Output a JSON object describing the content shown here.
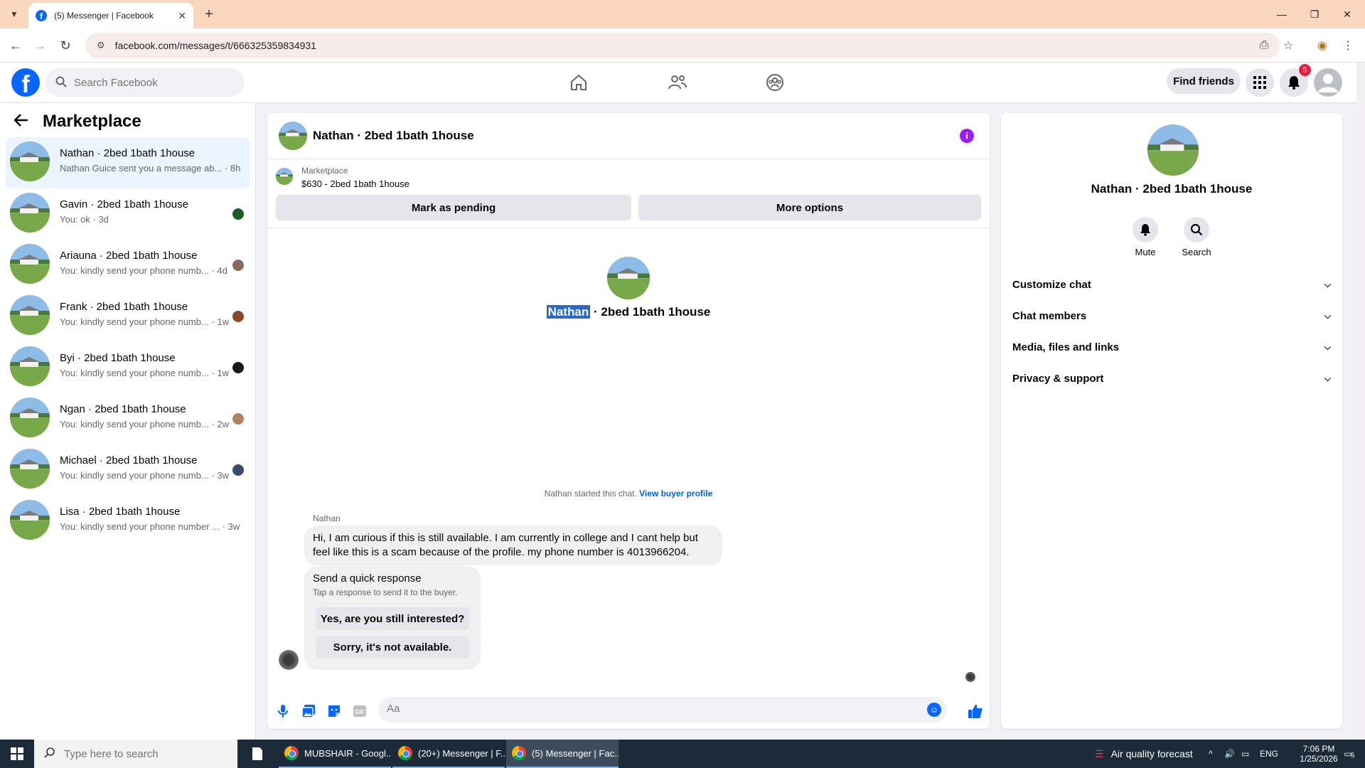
{
  "browser": {
    "tab_title": "(5) Messenger | Facebook",
    "url": "facebook.com/messages/t/666325359834931"
  },
  "fb": {
    "search_placeholder": "Search Facebook",
    "find_friends": "Find friends",
    "notification_count": "5"
  },
  "sidebar": {
    "title": "Marketplace",
    "conversations": [
      {
        "name": "Nathan · 2bed 1bath 1house",
        "preview": "Nathan Guice sent you a message ab... · 8h",
        "mini_color": ""
      },
      {
        "name": "Gavin · 2bed 1bath 1house",
        "preview": "You: ok · 3d",
        "mini_color": "#1e5a2a"
      },
      {
        "name": "Ariauna · 2bed 1bath 1house",
        "preview": "You: kindly send your phone numb... · 4d",
        "mini_color": "#8a6a5a"
      },
      {
        "name": "Frank · 2bed 1bath 1house",
        "preview": "You: kindly send your phone numb... · 1w",
        "mini_color": "#8a4a2a"
      },
      {
        "name": "Byi · 2bed 1bath 1house",
        "preview": "You: kindly send your phone numb... · 1w",
        "mini_color": "#1a1a1a"
      },
      {
        "name": "Ngan · 2bed 1bath 1house",
        "preview": "You: kindly send your phone numb... · 2w",
        "mini_color": "#b08060"
      },
      {
        "name": "Michael · 2bed 1bath 1house",
        "preview": "You: kindly send your phone numb... · 3w",
        "mini_color": "#3a4a6a"
      },
      {
        "name": "Lisa · 2bed 1bath 1house",
        "preview": "You: kindly send your phone number ... · 3w",
        "mini_color": ""
      }
    ]
  },
  "chat": {
    "title": "Nathan · 2bed 1bath 1house",
    "listing_source": "Marketplace",
    "listing_price": "$630 - 2bed 1bath 1house",
    "mark_pending": "Mark as pending",
    "more_options": "More options",
    "hero_highlight": "Nathan",
    "hero_rest": " · 2bed 1bath 1house",
    "started_text": "Nathan started this chat. ",
    "view_buyer_profile": "View buyer profile",
    "sender": "Nathan",
    "message": "Hi, I am curious if this is still available. I am currently in college and I cant help but feel like this is a scam because of the profile. my phone number is 4013966204.",
    "quick_title": "Send a quick response",
    "quick_sub": "Tap a response to send it to the buyer.",
    "quick_1": "Yes, are you still interested?",
    "quick_2": "Sorry, it's not available.",
    "composer_placeholder": "Aa"
  },
  "details": {
    "name": "Nathan · 2bed 1bath 1house",
    "mute": "Mute",
    "search": "Search",
    "sections": [
      "Customize chat",
      "Chat members",
      "Media, files and links",
      "Privacy & support"
    ]
  },
  "taskbar": {
    "search_placeholder": "Type here to search",
    "apps": [
      "MUBSHAIR - Googl...",
      "(20+) Messenger | F...",
      "(5) Messenger | Fac..."
    ],
    "weather": "Air quality forecast",
    "lang": "ENG",
    "time": "7:06 PM",
    "date": "1/25/2026",
    "notif_count": "5"
  },
  "colors": {
    "brand": "#0866ff",
    "tab_strip": "#fbd7c0",
    "info": "#9b1df2",
    "highlight": "#2a68c9"
  }
}
